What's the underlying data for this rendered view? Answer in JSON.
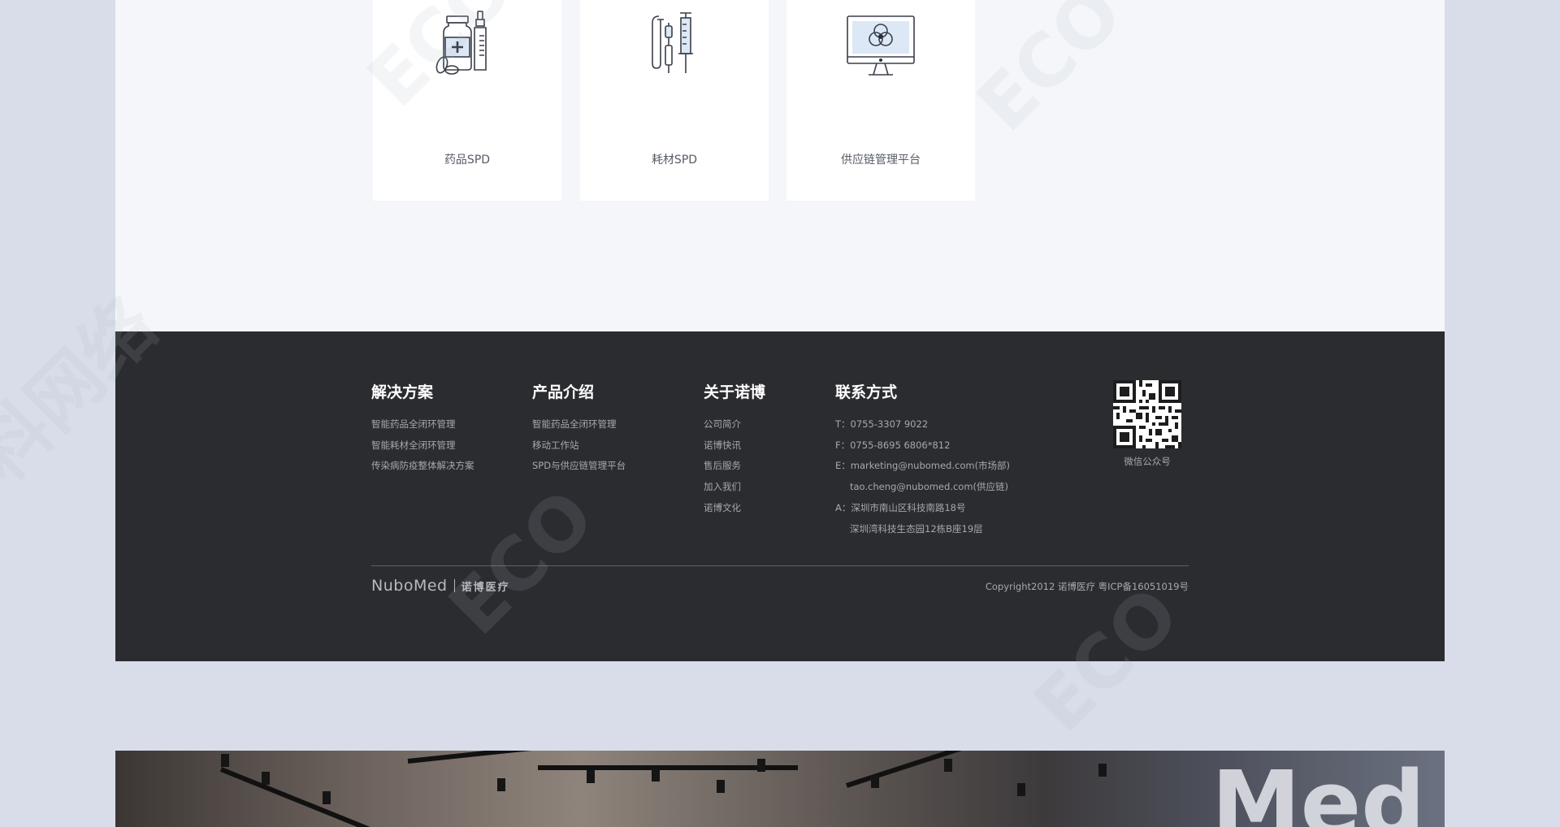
{
  "products": {
    "cards": [
      {
        "label": "药品SPD",
        "icon": "medicine-bottle-icon"
      },
      {
        "label": "耗材SPD",
        "icon": "syringe-iv-icon"
      },
      {
        "label": "供应链管理平台",
        "icon": "monitor-platform-icon"
      }
    ]
  },
  "footer": {
    "solutions": {
      "title": "解决方案",
      "items": [
        "智能药品全闭环管理",
        "智能耗材全闭环管理",
        "传染病防疫整体解决方案"
      ]
    },
    "products": {
      "title": "产品介绍",
      "items": [
        "智能药品全闭环管理",
        "移动工作站",
        "SPD与供应链管理平台"
      ]
    },
    "about": {
      "title": "关于诺博",
      "items": [
        "公司简介",
        "诺博快讯",
        "售后服务",
        "加入我们",
        "诺博文化"
      ]
    },
    "contact": {
      "title": "联系方式",
      "lines": [
        "T：0755-3307 9022",
        "F：0755-8695 6806*812",
        "E：marketing@nubomed.com(市场部)",
        "tao.cheng@nubomed.com(供应链)",
        "A：深圳市南山区科技南路18号",
        "深圳湾科技生态园12栋B座19层"
      ]
    },
    "qr_label": "微信公众号",
    "logo_en": "NuboMed",
    "logo_cn": "诺博医疗",
    "copyright": "Copyright2012 诺博医疗 粤ICP备16051019号"
  },
  "banner": {
    "sign_text": "Med"
  },
  "watermark": {
    "text": "ECO",
    "text2": "科网络"
  },
  "colors": {
    "page_bg": "#d8dde9",
    "section_bg": "#f4f6fa",
    "footer_bg": "#2b2c30",
    "footer_text": "#a6a8ae"
  }
}
